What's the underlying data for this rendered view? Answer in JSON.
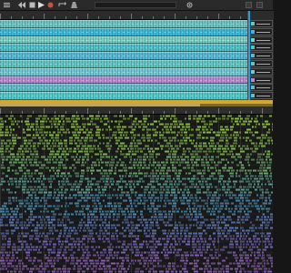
{
  "transport": {
    "buttons": [
      {
        "name": "menu-icon"
      },
      {
        "name": "record-icon"
      },
      {
        "name": "rewind-icon"
      },
      {
        "name": "play-icon"
      },
      {
        "name": "stop-icon"
      },
      {
        "name": "loop-icon"
      },
      {
        "name": "metronome-icon"
      },
      {
        "name": "settings-icon"
      }
    ]
  },
  "arrange": {
    "tracks": [
      {
        "color": "#6ac6c2"
      },
      {
        "color": "#3fb8d8"
      },
      {
        "color": "#79cfc6"
      },
      {
        "color": "#4ec0c9"
      },
      {
        "color": "#58b7d3"
      },
      {
        "color": "#5fc6c0"
      },
      {
        "color": "#74c7d0"
      },
      {
        "color": "#b78ad3"
      },
      {
        "color": "#5bbfc8"
      },
      {
        "color": "#56c7c4"
      }
    ],
    "selected_track_accent": "#1aa3e6"
  },
  "colors": {
    "divider": "#d6a62d",
    "grid_background": "#151515",
    "note_palette": [
      "#8cc23c",
      "#7eb84a",
      "#6fae6a",
      "#5a9f8f",
      "#4a8fb1",
      "#5d79b8",
      "#7466b7",
      "#8b5eb2"
    ]
  }
}
